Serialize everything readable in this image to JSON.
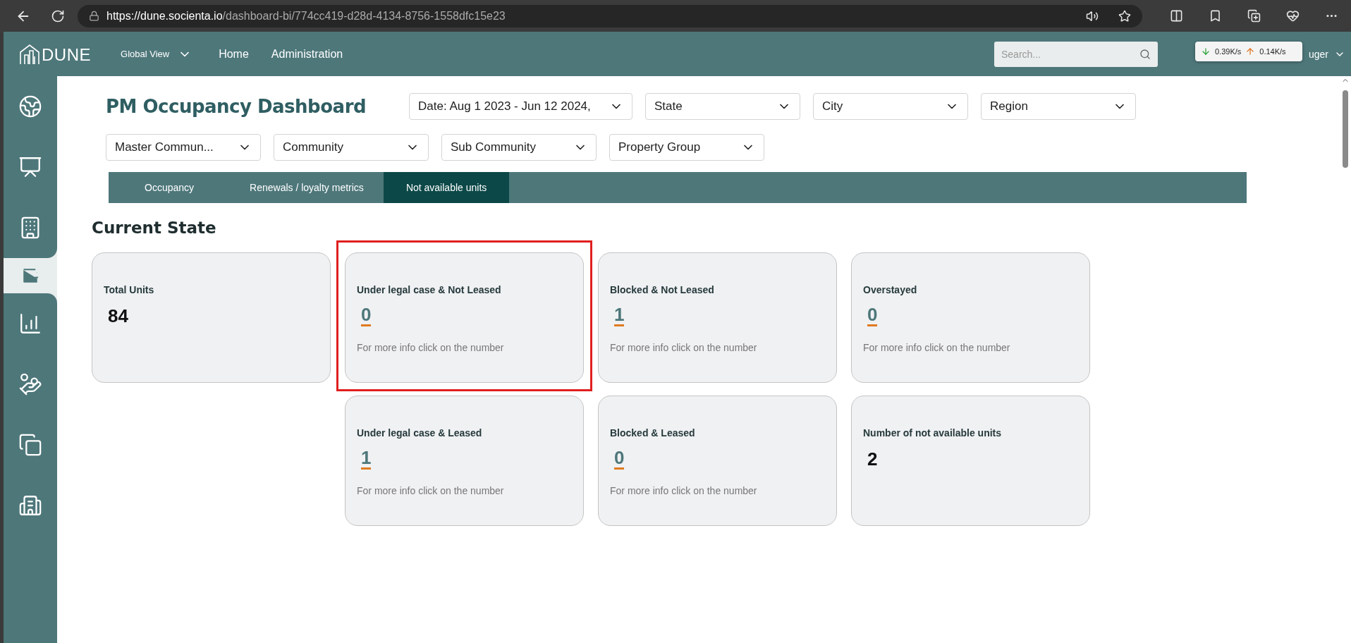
{
  "browser": {
    "url_host": "https://dune.socienta.io",
    "url_path": "/dashboard-bi/774cc419-d28d-4134-8756-1558dfc15e23"
  },
  "header": {
    "logo": "DUNE",
    "view_selector": "Global View",
    "nav": [
      {
        "label": "Home"
      },
      {
        "label": "Administration"
      }
    ],
    "search": {
      "placeholder": "Search..."
    },
    "user_name": "uger"
  },
  "network_widget": {
    "download": "0.39K/s",
    "upload": "0.14K/s"
  },
  "sidebar": {
    "items": [
      {
        "selected": false
      },
      {
        "selected": false
      },
      {
        "selected": false
      },
      {
        "selected": true
      },
      {
        "selected": false
      },
      {
        "selected": false
      },
      {
        "selected": false
      },
      {
        "selected": false
      }
    ]
  },
  "page": {
    "title": "PM Occupancy Dashboard",
    "filters": [
      {
        "label": "Date: Aug 1 2023 - Jun 12 2024,"
      },
      {
        "label": "State"
      },
      {
        "label": "City"
      },
      {
        "label": "Region"
      },
      {
        "label": "Master Commun..."
      },
      {
        "label": "Community"
      },
      {
        "label": "Sub Community"
      },
      {
        "label": "Property Group"
      }
    ],
    "tabs": [
      {
        "label": "Occupancy",
        "selected": false
      },
      {
        "label": "Renewals / loyalty metrics",
        "selected": false
      },
      {
        "label": "Not available units",
        "selected": true
      }
    ],
    "section_title": "Current State",
    "card_rows": [
      {
        "cards": [
          {
            "kind": "count",
            "title": "Total Units",
            "value": "84",
            "highlighted": false
          },
          {
            "kind": "link",
            "title": "Under legal case & Not Leased",
            "value": "0",
            "hint": "For more info click on the number",
            "highlighted": true
          },
          {
            "kind": "link",
            "title": "Blocked & Not Leased",
            "value": "1",
            "hint": "For more info click on the number",
            "highlighted": false
          },
          {
            "kind": "link",
            "title": "Overstayed",
            "value": "0",
            "hint": "For more info click on the number",
            "highlighted": false
          }
        ]
      },
      {
        "cards": [
          {
            "kind": "link",
            "title": "Under legal case & Leased",
            "value": "1",
            "hint": "For more info click on the number",
            "highlighted": false
          },
          {
            "kind": "link",
            "title": "Blocked & Leased",
            "value": "0",
            "hint": "For more info click on the number",
            "highlighted": false
          },
          {
            "kind": "count",
            "title": "Number of not available units",
            "value": "2",
            "highlighted": false
          }
        ]
      }
    ]
  }
}
